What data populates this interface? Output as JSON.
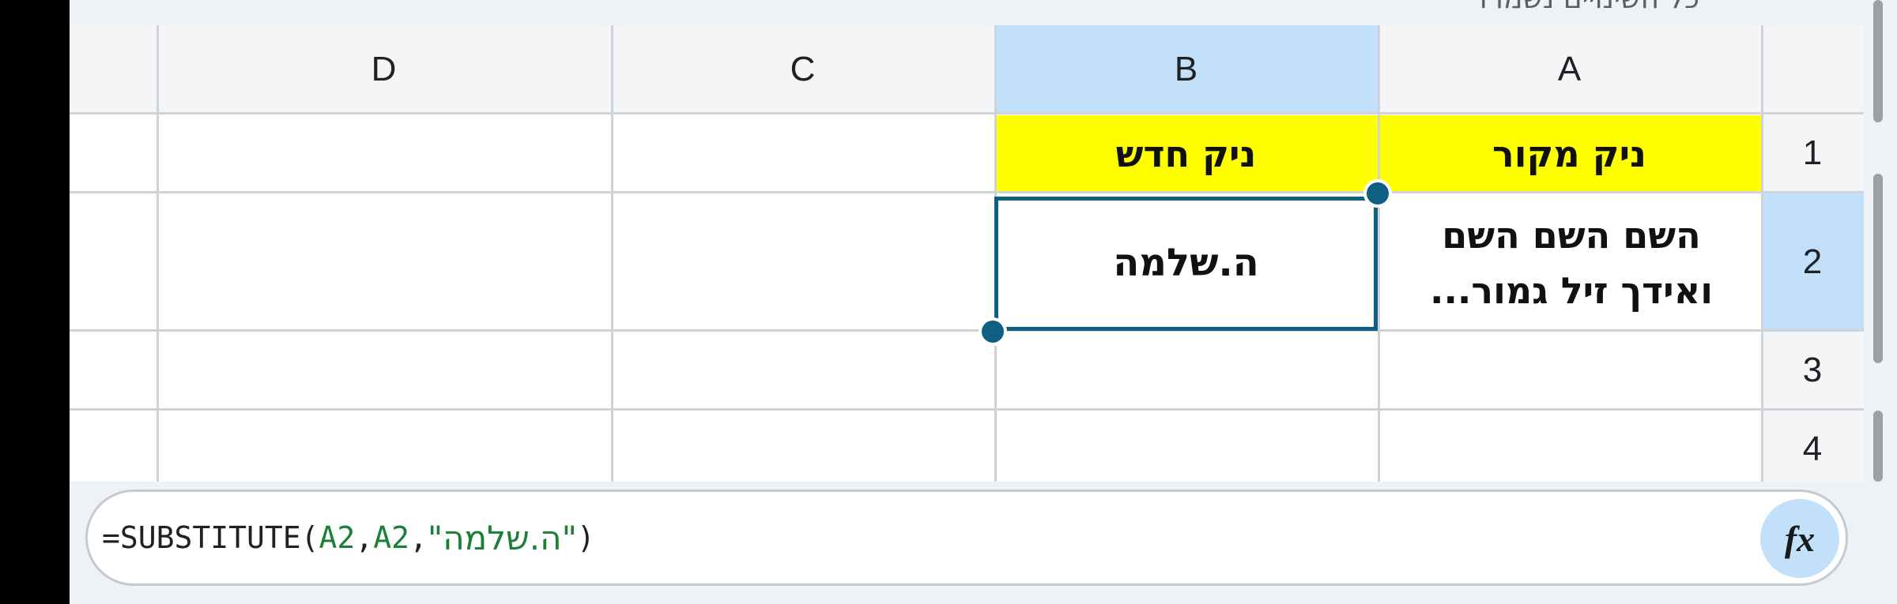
{
  "topbar": {
    "text": "כל השינויים נשמרו"
  },
  "columns": [
    "D",
    "C",
    "B",
    "A"
  ],
  "rows": [
    "1",
    "2",
    "3",
    "4"
  ],
  "cells": {
    "A1": "ניק מקור",
    "B1": "ניק חדש",
    "A2": "השם השם השם ואידך זיל גמור...",
    "B2": "ה.שלמה"
  },
  "selection": {
    "cell": "B2",
    "column": "B",
    "row": "2"
  },
  "formula": {
    "prefix": "=SUBSTITUTE(",
    "arg1": "A2",
    "sep1": ",",
    "arg2": "A2",
    "sep2": ",",
    "arg3": "\"ה.שלמה\"",
    "suffix": ")"
  },
  "fx_button": {
    "label": "fx"
  },
  "colors": {
    "header_fill": "#ffff00",
    "selection": "#0f5f82",
    "selected_header": "#c2e0f9"
  }
}
